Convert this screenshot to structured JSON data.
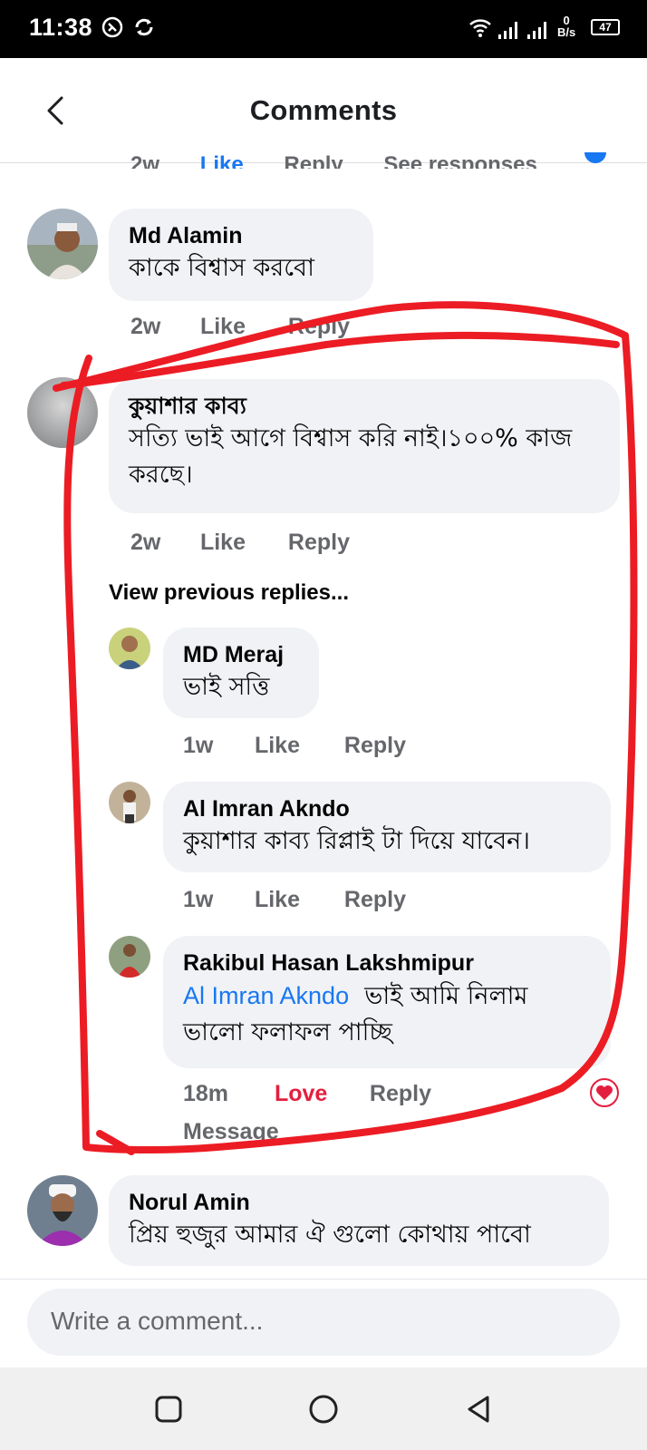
{
  "status_bar": {
    "time": "11:38",
    "net_speed_value": "0",
    "net_speed_unit": "B/s",
    "battery": "47"
  },
  "header": {
    "title": "Comments"
  },
  "cutoff_row": {
    "items": [
      "2w",
      "Like",
      "Reply",
      "See responses"
    ]
  },
  "comments": [
    {
      "name": "Md Alamin",
      "text": "কাকে বিশ্বাস করবো",
      "time": "2w",
      "like": "Like",
      "reply": "Reply"
    },
    {
      "name": "কুয়াশার কাব্য",
      "text": "সত্যি ভাই আগে বিশ্বাস করি নাই।১০০% কাজ করছে।",
      "time": "2w",
      "like": "Like",
      "reply": "Reply"
    }
  ],
  "view_previous_replies": "View previous replies...",
  "replies": [
    {
      "name": "MD Meraj",
      "text": "ভাই সত্তি",
      "time": "1w",
      "like": "Like",
      "reply": "Reply"
    },
    {
      "name": "Al Imran Akndo",
      "text": "কুয়াশার কাব্য রিপ্লাই টা দিয়ে যাবেন।",
      "time": "1w",
      "like": "Like",
      "reply": "Reply"
    },
    {
      "name": "Rakibul Hasan Lakshmipur",
      "mention": "Al Imran Akndo",
      "text": "ভাই আমি নিলাম ভালো ফলাফল পাচ্ছি",
      "time": "18m",
      "like": "Love",
      "reply": "Reply",
      "message": "Message"
    }
  ],
  "last_comment": {
    "name": "Norul Amin",
    "text": "প্রিয় হুজুর আমার ঐ গুলো কোথায় পাবো"
  },
  "composer": {
    "placeholder": "Write a comment..."
  },
  "colors": {
    "love": "#e41e3f",
    "mention": "#1877f2",
    "annotation": "#ec1c24"
  },
  "icons": [
    "back-arrow-icon",
    "circle-icon",
    "sync-icon",
    "wifi-icon",
    "signal-icon",
    "square-nav-icon",
    "home-nav-icon",
    "back-nav-icon",
    "heart-reaction-icon"
  ]
}
